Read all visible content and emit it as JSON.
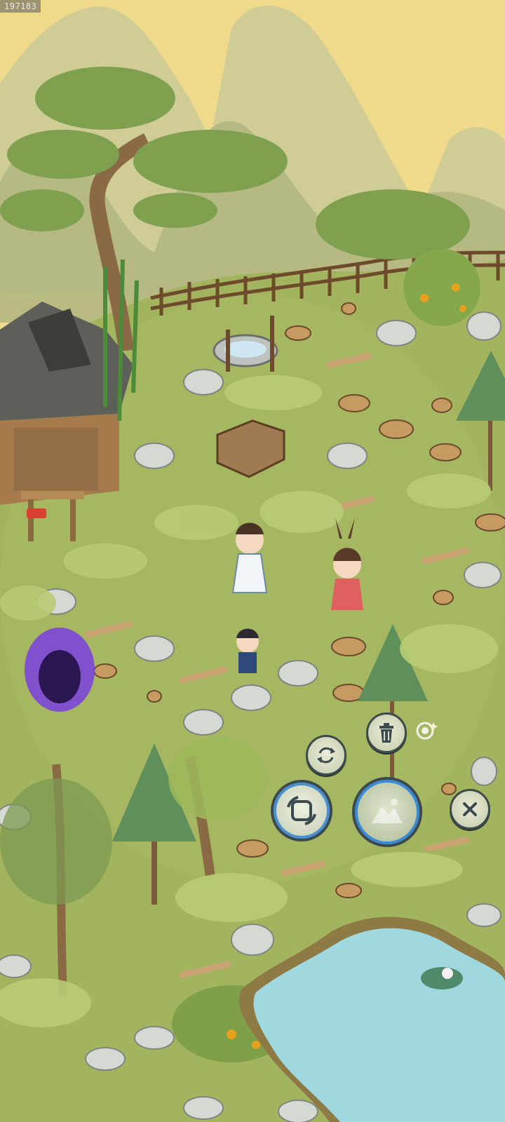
{
  "hud": {
    "id_tag": "197183"
  },
  "icons": {
    "recycle": "recycle-arrows-icon",
    "trash": "trash-can-icon",
    "locate": "target-sparkle-icon",
    "rotate": "rotate-frame-icon",
    "confirm": "confirm-placement-icon",
    "close": "close-x-icon"
  },
  "colors": {
    "sky": "#efd98a",
    "mountain": "#b7bb8c",
    "grass": "#9fb25a",
    "pond": "#9fd8df",
    "portal": "#7a3fe0",
    "hud_ring": "#3b8ad6"
  }
}
